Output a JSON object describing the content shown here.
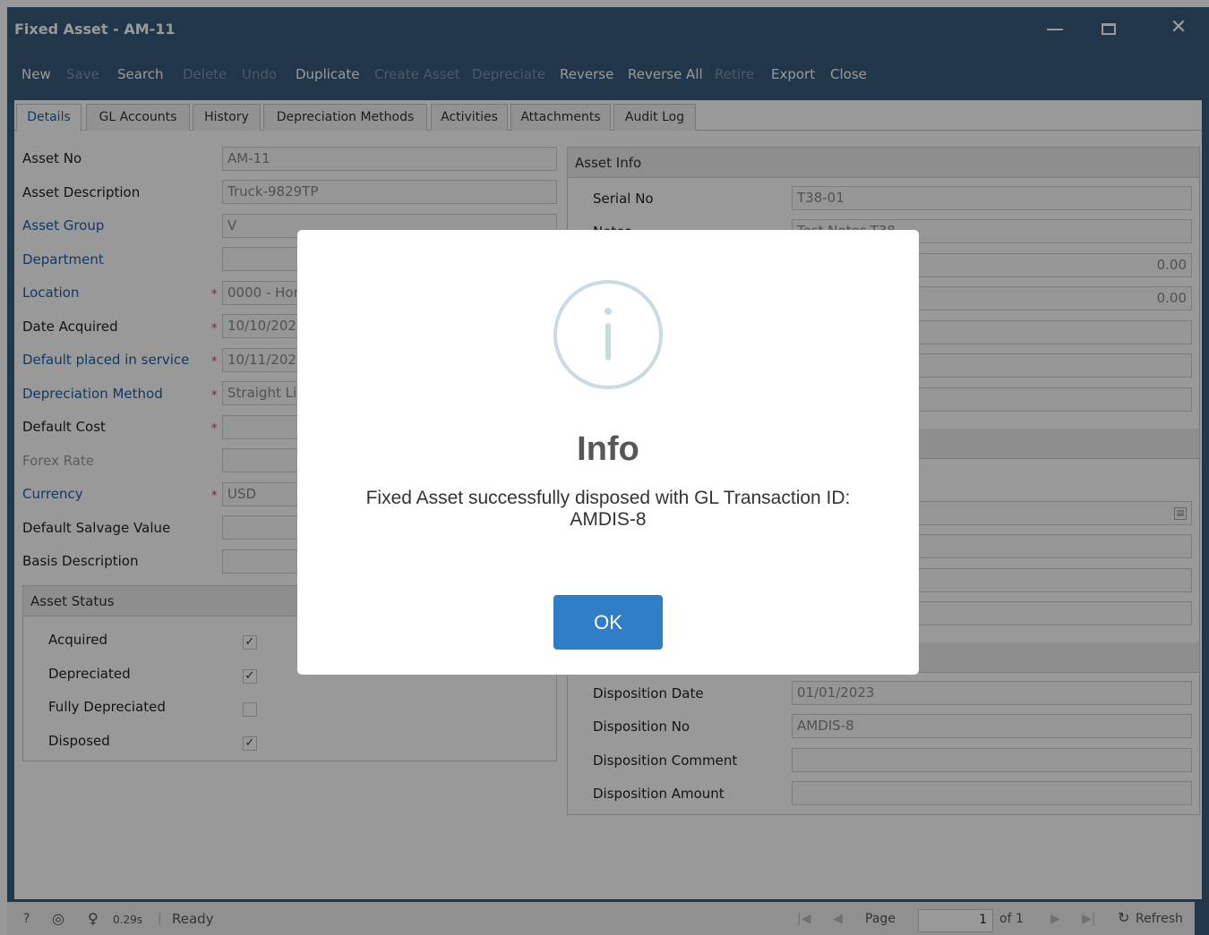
{
  "window": {
    "title": "Fixed Asset - AM-11"
  },
  "toolbar": {
    "new": "New",
    "save": "Save",
    "search": "Search",
    "delete": "Delete",
    "undo": "Undo",
    "duplicate": "Duplicate",
    "create_asset": "Create Asset",
    "depreciate": "Depreciate",
    "reverse": "Reverse",
    "reverse_all": "Reverse All",
    "retire": "Retire",
    "export": "Export",
    "close": "Close"
  },
  "tabs": [
    "Details",
    "GL Accounts",
    "History",
    "Depreciation Methods",
    "Activities",
    "Attachments",
    "Audit Log"
  ],
  "left": {
    "asset_no": {
      "label": "Asset No",
      "value": "AM-11"
    },
    "asset_description": {
      "label": "Asset Description",
      "value": "Truck-9829TP"
    },
    "asset_group": {
      "label": "Asset Group",
      "value": "V"
    },
    "department": {
      "label": "Department",
      "value": ""
    },
    "location": {
      "label": "Location",
      "value": "0000 - Hom"
    },
    "date_acquired": {
      "label": "Date Acquired",
      "value": "10/10/2022"
    },
    "placed_in_service": {
      "label": "Default placed in service",
      "value": "10/11/2022"
    },
    "depreciation_method": {
      "label": "Depreciation Method",
      "value": "Straight Lin"
    },
    "default_cost": {
      "label": "Default Cost",
      "value": ""
    },
    "forex_rate": {
      "label": "Forex Rate",
      "value": ""
    },
    "currency": {
      "label": "Currency",
      "value": "USD"
    },
    "salvage_value": {
      "label": "Default Salvage Value",
      "value": ""
    },
    "basis_description": {
      "label": "Basis Description",
      "value": ""
    }
  },
  "asset_status": {
    "title": "Asset Status",
    "acquired": {
      "label": "Acquired",
      "mark": "✓"
    },
    "depreciated": {
      "label": "Depreciated",
      "mark": "✓"
    },
    "fully_depreciated": {
      "label": "Fully Depreciated",
      "mark": ""
    },
    "disposed": {
      "label": "Disposed",
      "mark": "✓"
    }
  },
  "asset_info": {
    "title": "Asset Info",
    "serial_no": {
      "label": "Serial No",
      "value": "T38-01"
    },
    "notes": {
      "label": "Notes",
      "value": "Test Notes-T38"
    },
    "amount1": "0.00",
    "amount2": "0.00"
  },
  "disposition": {
    "date": {
      "label": "Disposition Date",
      "value": "01/01/2023"
    },
    "no": {
      "label": "Disposition No",
      "value": "AMDIS-8"
    },
    "comment": {
      "label": "Disposition Comment",
      "value": ""
    },
    "amount": {
      "label": "Disposition Amount",
      "value": ""
    }
  },
  "statusbar": {
    "help": "?",
    "time": "0.29s",
    "status": "Ready",
    "page_label": "Page",
    "page": "1",
    "of": "of 1",
    "refresh": "Refresh"
  },
  "modal": {
    "title": "Info",
    "message": "Fixed Asset successfully disposed with GL Transaction ID: AMDIS-8",
    "ok": "OK"
  }
}
